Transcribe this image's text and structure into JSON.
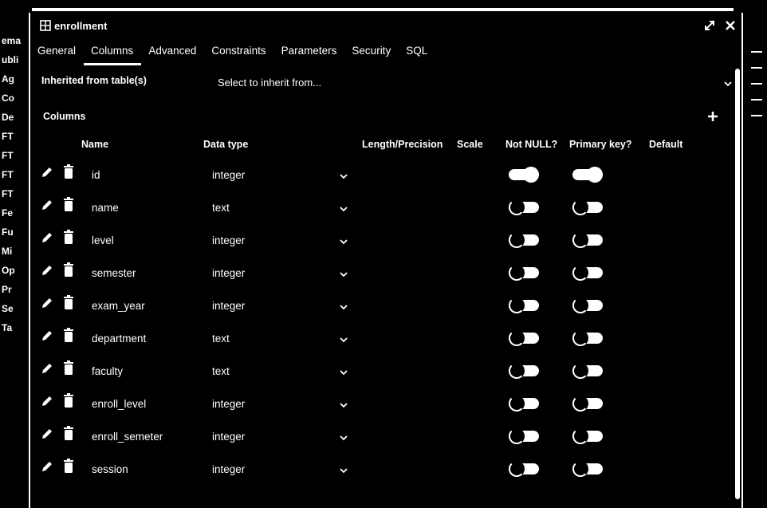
{
  "background": {
    "left_labels": [
      "ema",
      "ubli",
      "Ag",
      "Co",
      "De",
      "FT",
      "FT",
      "FT",
      "FT",
      "Fe",
      "Fu",
      "Mi",
      "Op",
      "Pr",
      "Se",
      "Ta"
    ]
  },
  "dialog": {
    "title": "enrollment",
    "title_icon": "table-icon",
    "expand_icon": "expand-icon",
    "close_icon": "close-icon"
  },
  "tabs": [
    {
      "label": "General",
      "active": false
    },
    {
      "label": "Columns",
      "active": true
    },
    {
      "label": "Advanced",
      "active": false
    },
    {
      "label": "Constraints",
      "active": false
    },
    {
      "label": "Parameters",
      "active": false
    },
    {
      "label": "Security",
      "active": false
    },
    {
      "label": "SQL",
      "active": false
    }
  ],
  "inherit": {
    "label": "Inherited from table(s)",
    "placeholder": "Select to inherit from..."
  },
  "columns_section": {
    "title": "Columns",
    "headers": {
      "name": "Name",
      "data_type": "Data type",
      "length": "Length/Precision",
      "scale": "Scale",
      "not_null": "Not NULL?",
      "primary_key": "Primary key?",
      "default": "Default"
    },
    "rows": [
      {
        "name": "id",
        "data_type": "integer",
        "not_null": true,
        "primary_key": true
      },
      {
        "name": "name",
        "data_type": "text",
        "not_null": false,
        "primary_key": false
      },
      {
        "name": "level",
        "data_type": "integer",
        "not_null": false,
        "primary_key": false
      },
      {
        "name": "semester",
        "data_type": "integer",
        "not_null": false,
        "primary_key": false
      },
      {
        "name": "exam_year",
        "data_type": "integer",
        "not_null": false,
        "primary_key": false
      },
      {
        "name": "department",
        "data_type": "text",
        "not_null": false,
        "primary_key": false
      },
      {
        "name": "faculty",
        "data_type": "text",
        "not_null": false,
        "primary_key": false
      },
      {
        "name": "enroll_level",
        "data_type": "integer",
        "not_null": false,
        "primary_key": false
      },
      {
        "name": "enroll_semeter",
        "data_type": "integer",
        "not_null": false,
        "primary_key": false
      },
      {
        "name": "session",
        "data_type": "integer",
        "not_null": false,
        "primary_key": false
      }
    ]
  },
  "colors": {
    "background": "#000000",
    "foreground": "#ffffff"
  }
}
